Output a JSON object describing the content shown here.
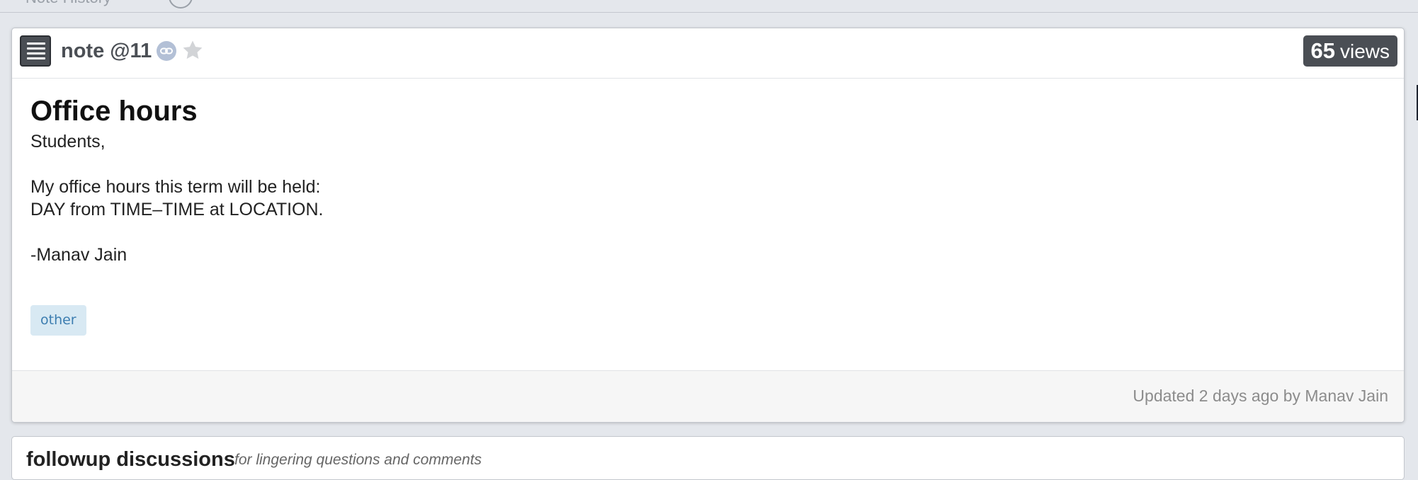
{
  "top_bar": {
    "history_label": "Note History"
  },
  "note": {
    "title": "note @11",
    "views_count": "65",
    "views_label": "views",
    "subject": "Office hours",
    "content_lines": [
      "Students,",
      "",
      "My office hours this term will be held:",
      "DAY from TIME–TIME at LOCATION.",
      "",
      "-Manav Jain"
    ],
    "tags": [
      "other"
    ],
    "updated_text": "Updated 2 days ago by Manav Jain"
  },
  "followup": {
    "title": "followup discussions",
    "subtitle": "for lingering questions and comments"
  },
  "icons": {
    "menu": "hamburger-menu-icon",
    "link": "link-icon",
    "star": "star-icon"
  },
  "colors": {
    "badge_bg": "#4a4e54",
    "tag_bg": "#d8e9f3",
    "tag_text": "#3c7db0",
    "link_icon_bg": "#b3c0d6",
    "footer_bg": "#f6f6f6"
  }
}
